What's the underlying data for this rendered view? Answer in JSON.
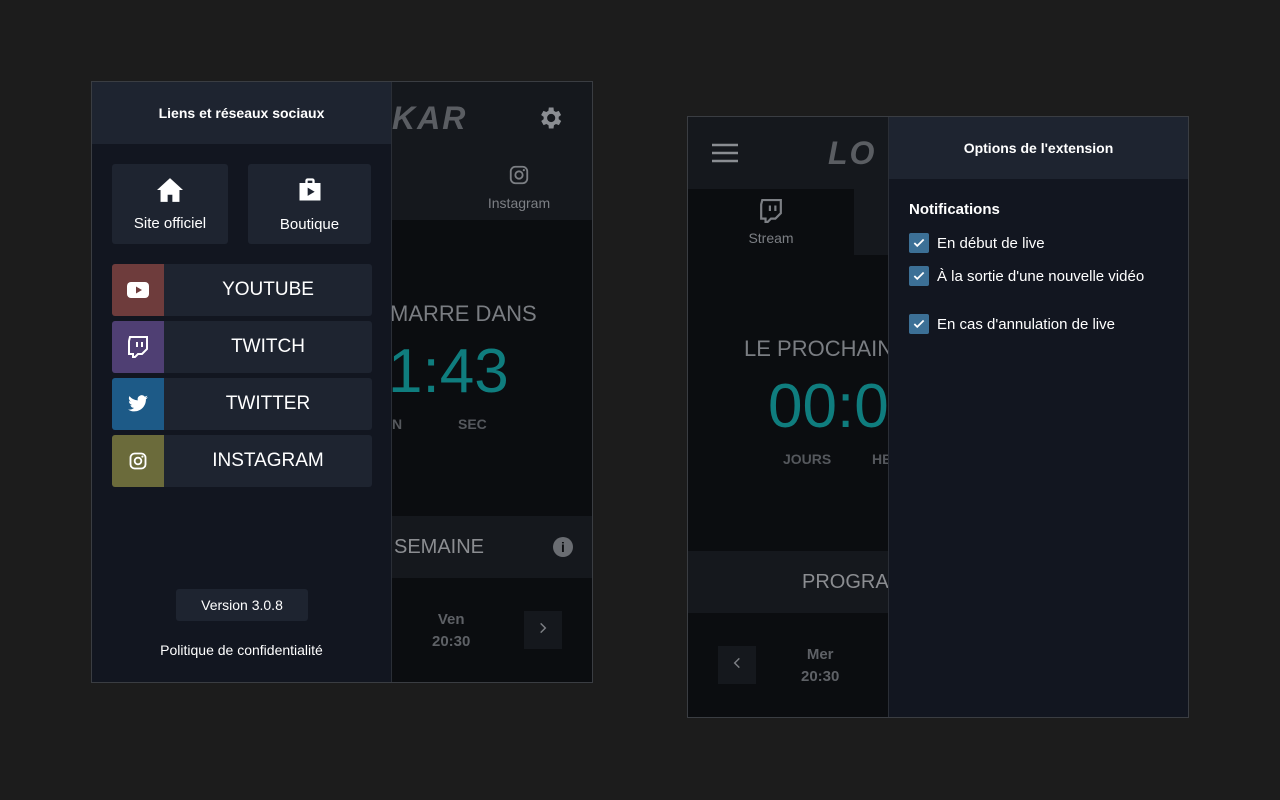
{
  "left_popup": {
    "background_app": {
      "logo_fragment": "KAR",
      "tab_instagram": "Instagram",
      "countdown_title": "MARRE DANS",
      "countdown_digits": "1:43",
      "unit_min": "N",
      "unit_sec": "SEC",
      "week_title": "SEMAINE",
      "schedule": {
        "day": "Ven",
        "time": "20:30"
      }
    },
    "drawer": {
      "title": "Liens et réseaux sociaux",
      "quick_links": [
        {
          "label": "Site officiel",
          "icon": "home-icon"
        },
        {
          "label": "Boutique",
          "icon": "shop-bag-icon"
        }
      ],
      "socials": [
        {
          "label": "YOUTUBE",
          "icon": "youtube-icon",
          "color": "#6e3c3c"
        },
        {
          "label": "TWITCH",
          "icon": "twitch-icon",
          "color": "#4f3f73"
        },
        {
          "label": "TWITTER",
          "icon": "twitter-icon",
          "color": "#1d5a87"
        },
        {
          "label": "INSTAGRAM",
          "icon": "instagram-icon",
          "color": "#6b6b3b"
        }
      ],
      "version": "Version 3.0.8",
      "privacy": "Politique de confidentialité"
    }
  },
  "right_popup": {
    "background_app": {
      "logo_fragment": "LO",
      "tab_stream": "Stream",
      "countdown_title": "LE PROCHAIN",
      "countdown_digits": "00:0",
      "unit_days": "JOURS",
      "unit_hours": "HE",
      "program_title": "PROGRAM",
      "schedule": {
        "day": "Mer",
        "time": "20:30"
      }
    },
    "drawer": {
      "title": "Options de l'extension",
      "section": "Notifications",
      "options": [
        {
          "label": "En début de live",
          "checked": true
        },
        {
          "label": "À la sortie d'une nouvelle vidéo",
          "checked": true
        },
        {
          "label": "En cas d'annulation de live",
          "checked": true
        }
      ]
    }
  },
  "colors": {
    "accent_teal": "#0f7d7e",
    "checkbox": "#3c7096"
  }
}
